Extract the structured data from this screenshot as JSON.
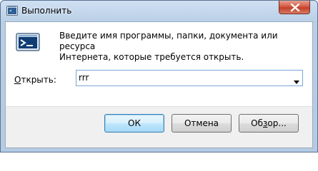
{
  "window": {
    "title": "Выполнить",
    "close_icon": "close-x-icon"
  },
  "content": {
    "icon": "run-program-icon",
    "description_line1": "Введите имя программы, папки, документа или ресурса",
    "description_line2": "Интернета, которые требуется открыть."
  },
  "open_field": {
    "label_accel": "О",
    "label_rest": "ткрыть:",
    "value": "rrr",
    "dropdown_icon": "chevron-down-icon"
  },
  "buttons": {
    "ok": "ОК",
    "cancel": "Отмена",
    "browse_pre": "Об",
    "browse_accel": "з",
    "browse_post": "ор..."
  },
  "colors": {
    "titlebar": "#b9cfe6",
    "close_button": "#c2412b",
    "default_button_border": "#3c7fb1",
    "field_border": "#7aa7d6"
  }
}
